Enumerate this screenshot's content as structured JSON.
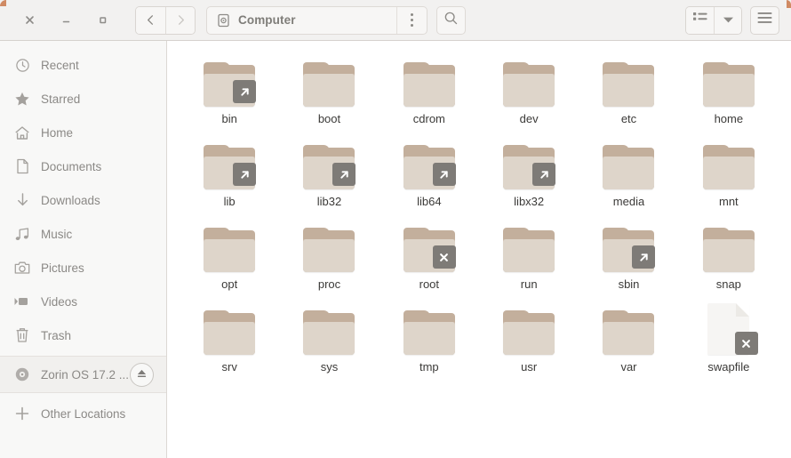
{
  "window": {
    "controls": {
      "close_label": "×",
      "minimize_label": "–",
      "maximize_label": "□"
    },
    "accent_color": "#d08a63"
  },
  "header": {
    "back_label": "Back",
    "forward_label": "Forward",
    "path_label": "Computer",
    "path_icon": "computer-drive-icon",
    "path_menu_icon": "kebab-menu-icon",
    "search_icon": "search-icon",
    "view_list_icon": "list-view-icon",
    "view_dropdown_icon": "chevron-down-icon",
    "main_menu_icon": "hamburger-menu-icon"
  },
  "sidebar": {
    "items": [
      {
        "label": "Recent",
        "icon": "clock-icon"
      },
      {
        "label": "Starred",
        "icon": "star-icon"
      },
      {
        "label": "Home",
        "icon": "home-icon"
      },
      {
        "label": "Documents",
        "icon": "document-icon"
      },
      {
        "label": "Downloads",
        "icon": "download-arrow-icon"
      },
      {
        "label": "Music",
        "icon": "music-note-icon"
      },
      {
        "label": "Pictures",
        "icon": "camera-icon"
      },
      {
        "label": "Videos",
        "icon": "video-camera-icon"
      },
      {
        "label": "Trash",
        "icon": "trash-icon"
      }
    ],
    "device": {
      "label": "Zorin OS 17.2 ...",
      "icon": "disc-icon",
      "eject_icon": "eject-icon"
    },
    "other": {
      "label": "Other Locations",
      "icon": "plus-icon"
    }
  },
  "content": {
    "items": [
      {
        "name": "bin",
        "type": "folder",
        "emblem": "symlink"
      },
      {
        "name": "boot",
        "type": "folder",
        "emblem": null
      },
      {
        "name": "cdrom",
        "type": "folder",
        "emblem": null
      },
      {
        "name": "dev",
        "type": "folder",
        "emblem": null
      },
      {
        "name": "etc",
        "type": "folder",
        "emblem": null
      },
      {
        "name": "home",
        "type": "folder",
        "emblem": null
      },
      {
        "name": "lib",
        "type": "folder",
        "emblem": "symlink"
      },
      {
        "name": "lib32",
        "type": "folder",
        "emblem": "symlink"
      },
      {
        "name": "lib64",
        "type": "folder",
        "emblem": "symlink"
      },
      {
        "name": "libx32",
        "type": "folder",
        "emblem": "symlink"
      },
      {
        "name": "media",
        "type": "folder",
        "emblem": null
      },
      {
        "name": "mnt",
        "type": "folder",
        "emblem": null
      },
      {
        "name": "opt",
        "type": "folder",
        "emblem": null
      },
      {
        "name": "proc",
        "type": "folder",
        "emblem": null
      },
      {
        "name": "root",
        "type": "folder",
        "emblem": "no-access"
      },
      {
        "name": "run",
        "type": "folder",
        "emblem": null
      },
      {
        "name": "sbin",
        "type": "folder",
        "emblem": "symlink"
      },
      {
        "name": "snap",
        "type": "folder",
        "emblem": null
      },
      {
        "name": "srv",
        "type": "folder",
        "emblem": null
      },
      {
        "name": "sys",
        "type": "folder",
        "emblem": null
      },
      {
        "name": "tmp",
        "type": "folder",
        "emblem": null
      },
      {
        "name": "usr",
        "type": "folder",
        "emblem": null
      },
      {
        "name": "var",
        "type": "folder",
        "emblem": null
      },
      {
        "name": "swapfile",
        "type": "file",
        "emblem": "no-access"
      }
    ]
  },
  "colors": {
    "folder_tab": "#c3af9c",
    "folder_body": "#ded5ca",
    "emblem_bg": "#7e7b77",
    "headerbar_bg": "#f2f1f0",
    "sidebar_bg": "#f8f8f7"
  }
}
